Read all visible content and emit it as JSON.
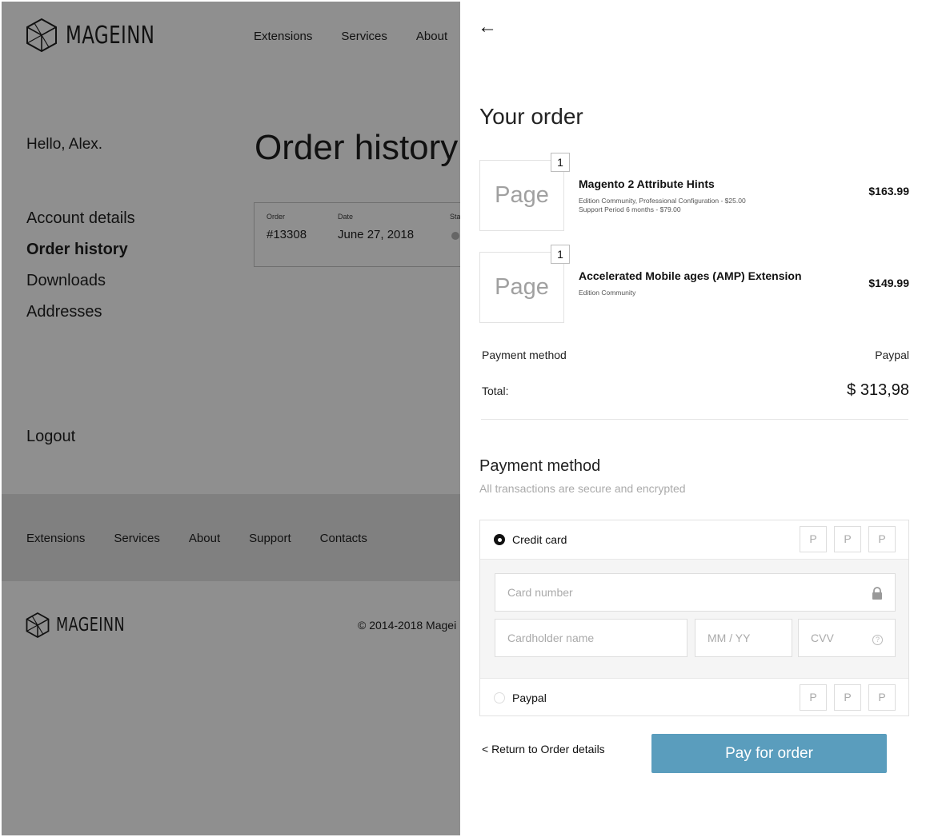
{
  "colors": {
    "overlay_bg": "#8f8f8f",
    "pay_button": "#5a9dbd",
    "drawer_bg": "#ffffff"
  },
  "background_page": {
    "logo_text": "MAGEINN",
    "top_nav": [
      "Extensions",
      "Services",
      "About"
    ],
    "greeting": "Hello, Alex.",
    "page_title": "Order history",
    "side_menu": [
      {
        "label": "Account details",
        "active": false
      },
      {
        "label": "Order history",
        "active": true
      },
      {
        "label": "Downloads",
        "active": false
      },
      {
        "label": "Addresses",
        "active": false
      }
    ],
    "logout": "Logout",
    "order_card": {
      "order_label": "Order",
      "order_value": "#13308",
      "date_label": "Date",
      "date_value": "June 27, 2018",
      "status_label": "Sta"
    },
    "footer_nav": [
      "Extensions",
      "Services",
      "About",
      "Support",
      "Contacts"
    ],
    "copyright": "© 2014-2018 Magei"
  },
  "drawer": {
    "back_icon": "arrow-left-icon",
    "title": "Your order",
    "items": [
      {
        "thumb": "Page",
        "qty": "1",
        "name": "Magento 2 Attribute Hints",
        "desc_line1": "Edition Community, Professional Configuration - $25.00",
        "desc_line2": "Support Period 6 months - $79.00",
        "price": "$163.99"
      },
      {
        "thumb": "Page",
        "qty": "1",
        "name": "Accelerated Mobile ages (AMP) Extension",
        "desc_line1": "Edition Community",
        "desc_line2": "",
        "price": "$149.99"
      }
    ],
    "summary": {
      "payment_label": "Payment method",
      "payment_value": "Paypal",
      "total_label": "Total:",
      "total_value": "$ 313,98"
    },
    "payment": {
      "title": "Payment method",
      "subtitle": "All transactions are secure and encrypted",
      "credit_card": {
        "label": "Credit card",
        "selected": true,
        "badges": [
          "P",
          "P",
          "P"
        ]
      },
      "fields": {
        "card_number_placeholder": "Card number",
        "cardholder_placeholder": "Cardholder name",
        "expiry_placeholder": "MM / YY",
        "cvv_placeholder": "CVV",
        "help_glyph": "?"
      },
      "paypal": {
        "label": "Paypal",
        "selected": false,
        "badges": [
          "P",
          "P",
          "P"
        ]
      }
    },
    "return_link": "< Return to Order details",
    "pay_button": "Pay for order"
  }
}
